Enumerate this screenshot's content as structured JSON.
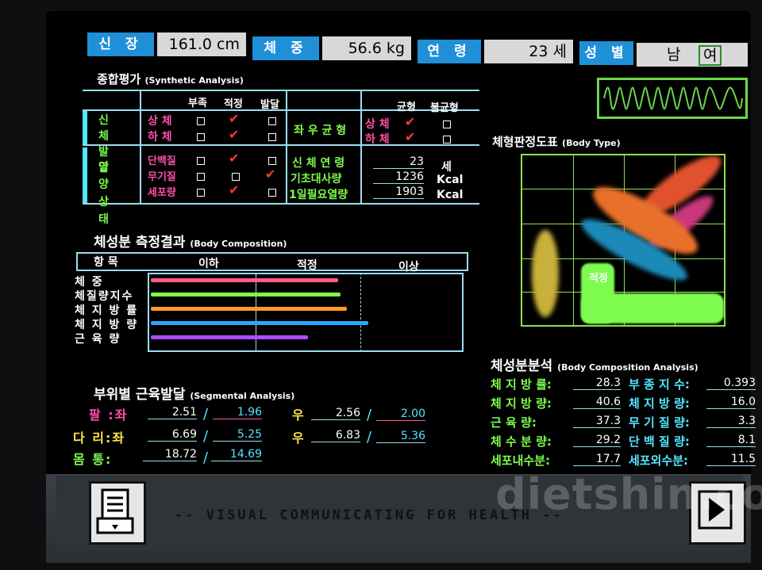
{
  "header": {
    "height_label": "신 장",
    "height_value": "161.0 cm",
    "weight_label": "체 중",
    "weight_value": "56.6 kg",
    "age_label": "연 령",
    "age_value": "23 세",
    "sex_label": "성 별",
    "sex_male": "남",
    "sex_female": "여"
  },
  "synthetic": {
    "title": "종합평가",
    "subtitle": "(Synthetic Analysis)",
    "col_low": "부족",
    "col_normal": "적정",
    "col_high": "발달",
    "col_balance": "균형",
    "col_imbalance": "불균형",
    "body_dev_label": "신 체 발 달",
    "body_upper": "상 체",
    "body_lower": "하 체",
    "balance_label": "좌 우 균 형",
    "bal_upper": "상 체",
    "bal_lower": "하 체",
    "nutrition_label": "영 양 상 태",
    "nut_protein": "단백질",
    "nut_mineral": "무기질",
    "nut_cell": "세포량",
    "body_age_label": "신 체 연 령",
    "body_age_value": "23",
    "body_age_unit": "세",
    "bmr_label": "기초대사량",
    "bmr_value": "1236",
    "bmr_unit": "Kcal",
    "daily_label": "1일필요열량",
    "daily_value": "1903",
    "daily_unit": "Kcal"
  },
  "composition": {
    "title": "체성분 측정결과",
    "subtitle": "(Body Composition)",
    "col_item": "항 목",
    "col_low": "이하",
    "col_normal": "적정",
    "col_high": "이상",
    "rows": [
      {
        "label": "체 중",
        "fill": 0.62,
        "color": "#ff5b8a"
      },
      {
        "label": "체질량지수",
        "fill": 0.63,
        "color": "#7dfb4e"
      },
      {
        "label": "체 지 방 률",
        "fill": 0.65,
        "color": "#ff9a2a"
      },
      {
        "label": "체 지 방 량",
        "fill": 0.72,
        "color": "#2aa8ff"
      },
      {
        "label": "근 육 량",
        "fill": 0.52,
        "color": "#b04cff"
      }
    ]
  },
  "segmental": {
    "title": "부위별 근육발달",
    "subtitle": "(Segmental Analysis)",
    "arm_label": "팔 :좌",
    "arm_left_a": "2.51",
    "arm_left_b": "1.96",
    "arm_right_label": "우",
    "arm_right_a": "2.56",
    "arm_right_b": "2.00",
    "leg_label": "다 리:좌",
    "leg_left_a": "6.69",
    "leg_left_b": "5.25",
    "leg_right_label": "우",
    "leg_right_a": "6.83",
    "leg_right_b": "5.36",
    "trunk_label": "몸 통:",
    "trunk_a": "18.72",
    "trunk_b": "14.69"
  },
  "body_type": {
    "title": "체형판정도표",
    "subtitle": "(Body Type)",
    "label_normal": "적정"
  },
  "bca": {
    "title": "체성분분석",
    "subtitle": "(Body Composition Analysis)",
    "left": [
      {
        "label": "체 지 방 률:",
        "value": "28.3"
      },
      {
        "label": "체 지 방 량:",
        "value": "40.6"
      },
      {
        "label": "근 육 량:",
        "value": "37.3"
      },
      {
        "label": "체 수 분 량:",
        "value": "29.2"
      },
      {
        "label": "세포내수분:",
        "value": "17.7"
      }
    ],
    "right": [
      {
        "label": "부 종 지 수:",
        "value": "0.393"
      },
      {
        "label": "체 지 방 량:",
        "value": "16.0"
      },
      {
        "label": "무 기 질 량:",
        "value": "3.3"
      },
      {
        "label": "단 백 질 량:",
        "value": "8.1"
      },
      {
        "label": "세포외수분:",
        "value": "11.5"
      }
    ]
  },
  "footer": {
    "tagline": "-- VISUAL COMMUNICATING FOR HEALTH --",
    "watermark": "dietshin.com"
  }
}
